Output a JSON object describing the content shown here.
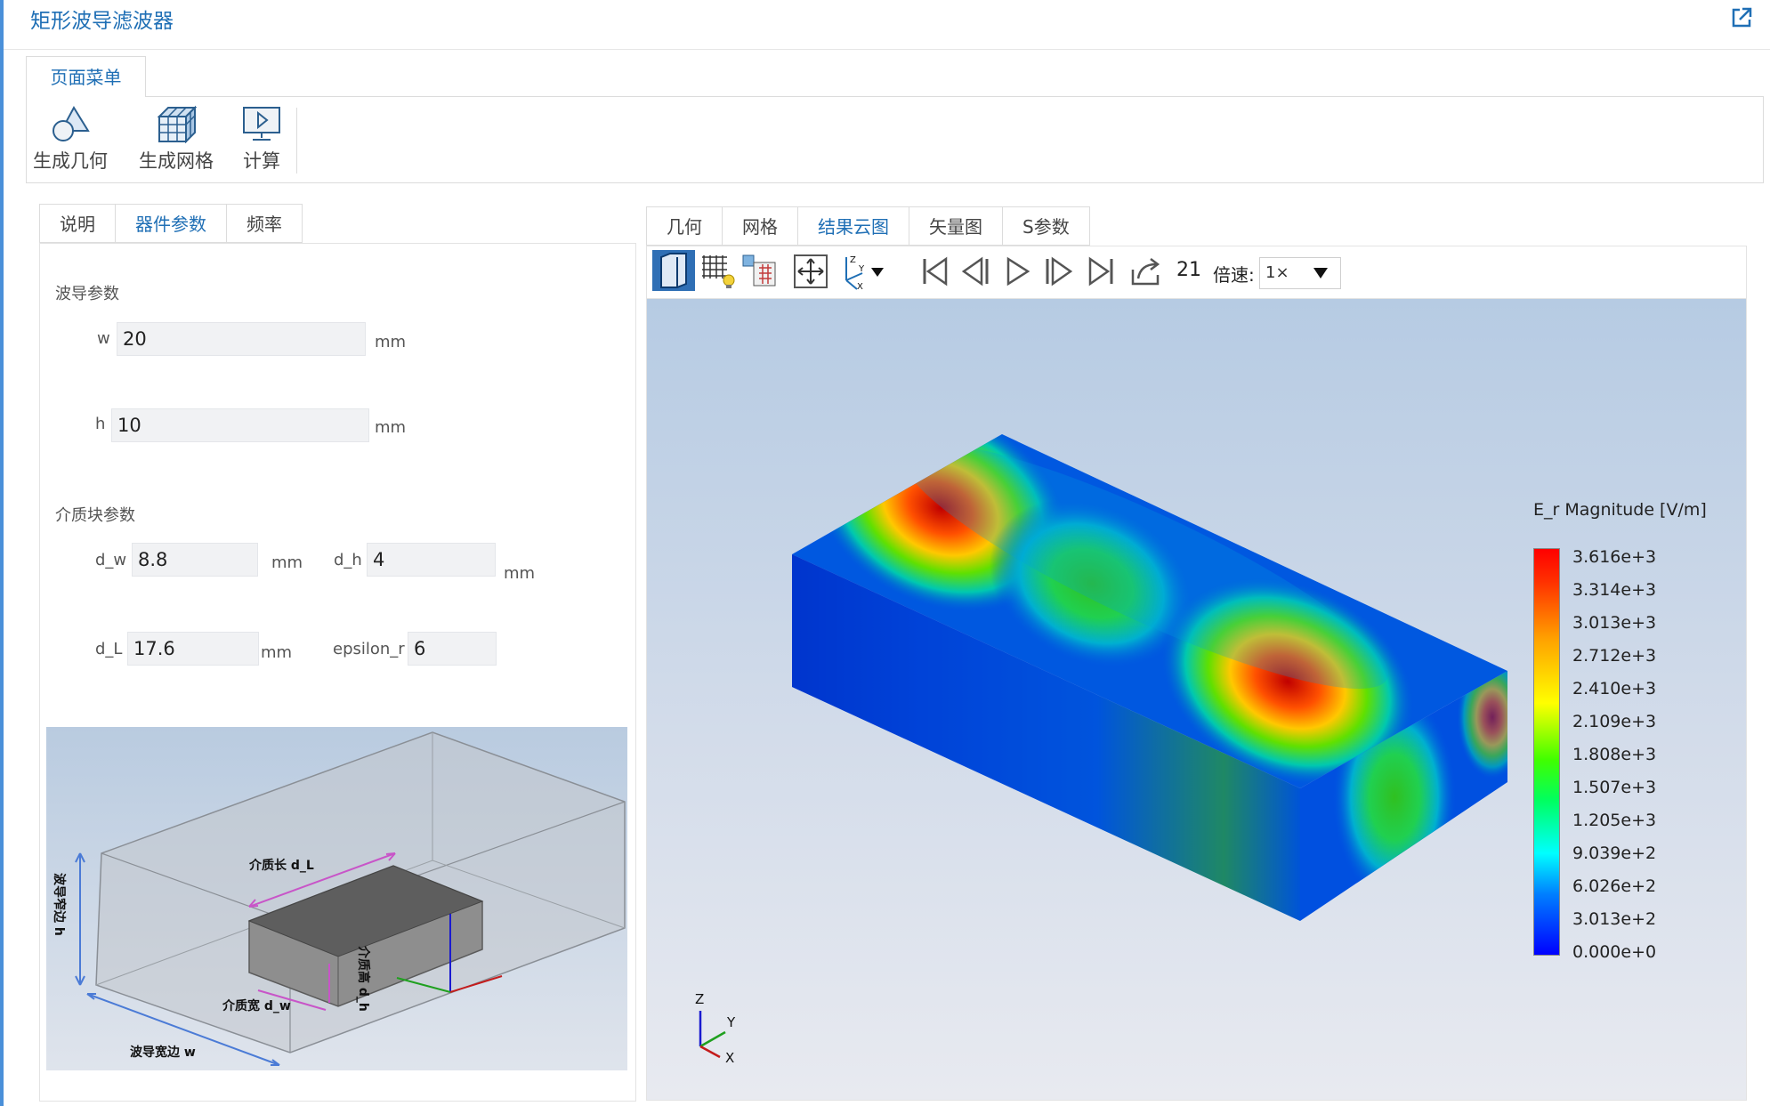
{
  "app": {
    "title": "矩形波导滤波器"
  },
  "menu": {
    "tab_label": "页面菜单",
    "buttons": [
      {
        "label": "生成几何",
        "icon": "geometry-icon"
      },
      {
        "label": "生成网格",
        "icon": "mesh-icon"
      },
      {
        "label": "计算",
        "icon": "compute-icon"
      }
    ]
  },
  "left_panel": {
    "tabs": [
      "说明",
      "器件参数",
      "频率"
    ],
    "active_tab": "器件参数",
    "waveguide_section": "波导参数",
    "w": {
      "label": "w",
      "value": "20",
      "unit": "mm"
    },
    "h": {
      "label": "h",
      "value": "10",
      "unit": "mm"
    },
    "dielectric_section": "介质块参数",
    "d_w": {
      "label": "d_w",
      "value": "8.8",
      "unit": "mm"
    },
    "d_h": {
      "label": "d_h",
      "value": "4",
      "unit": "mm"
    },
    "d_L": {
      "label": "d_L",
      "value": "17.6",
      "unit": "mm"
    },
    "epsilon_r": {
      "label": "epsilon_r",
      "value": "6"
    },
    "diagram_labels": {
      "length": "介质长 d_L",
      "width": "介质宽 d_w",
      "height": "介质高 d_h",
      "wg_height": "波导窄边 h",
      "wg_width": "波导宽边 w"
    }
  },
  "right_panel": {
    "tabs": [
      "几何",
      "网格",
      "结果云图",
      "矢量图",
      "S参数"
    ],
    "active_tab": "结果云图",
    "frame": "21",
    "speed_label": "倍速:",
    "speed_value": "1×",
    "colorbar": {
      "title": "E_r Magnitude [V/m]",
      "labels": [
        "3.616e+3",
        "3.314e+3",
        "3.013e+3",
        "2.712e+3",
        "2.410e+3",
        "2.109e+3",
        "1.808e+3",
        "1.507e+3",
        "1.205e+3",
        "9.039e+2",
        "6.026e+2",
        "3.013e+2",
        "0.000e+0"
      ]
    },
    "axes": {
      "z": "Z",
      "y": "Y",
      "x": "X"
    }
  },
  "colors": {
    "accent": "#1f6fb5",
    "sidebar_accent": "#4a90d9"
  }
}
